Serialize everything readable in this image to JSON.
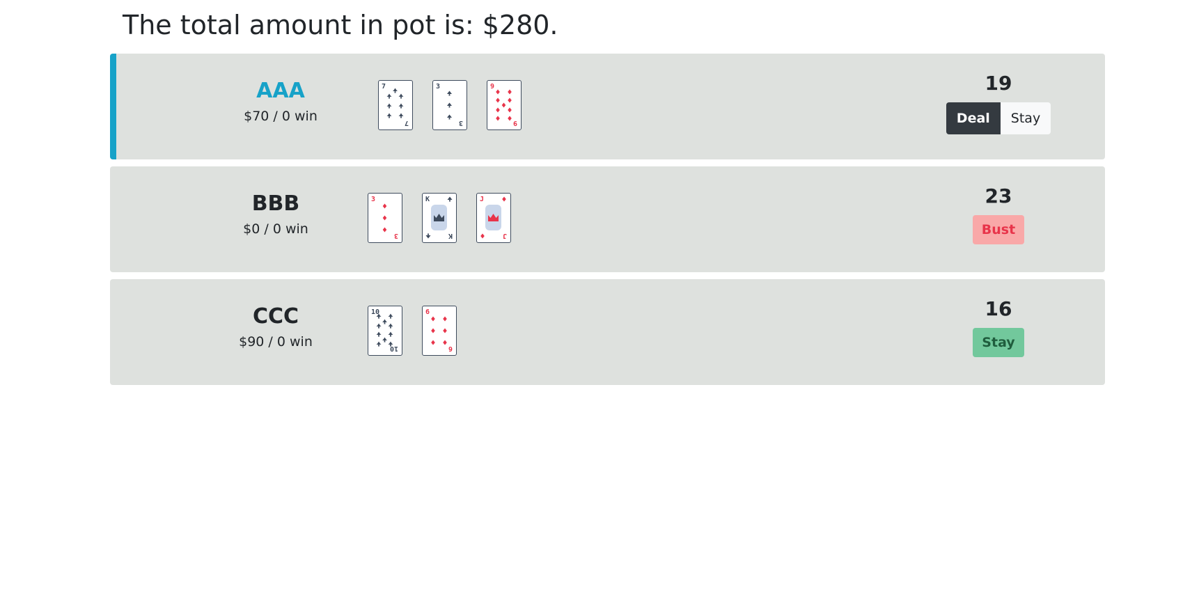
{
  "pot": {
    "title": "The total amount in pot is: $280."
  },
  "players": [
    {
      "name": "AAA",
      "money_text": "$70 / 0 win",
      "active": true,
      "score": "19",
      "status": "playing",
      "actions": {
        "deal_label": "Deal",
        "stay_label": "Stay"
      },
      "cards": [
        {
          "rank": "7",
          "suit": "clubs",
          "color": "#3d4a5c"
        },
        {
          "rank": "3",
          "suit": "spades",
          "color": "#3d4a5c"
        },
        {
          "rank": "9",
          "suit": "diamonds",
          "color": "#e8344a"
        }
      ]
    },
    {
      "name": "BBB",
      "money_text": "$0 / 0 win",
      "active": false,
      "score": "23",
      "status": "bust",
      "status_label": "Bust",
      "cards": [
        {
          "rank": "3",
          "suit": "diamonds",
          "color": "#e8344a"
        },
        {
          "rank": "K",
          "suit": "spades",
          "color": "#3d4a5c"
        },
        {
          "rank": "J",
          "suit": "diamonds",
          "color": "#e8344a"
        }
      ]
    },
    {
      "name": "CCC",
      "money_text": "$90 / 0 win",
      "active": false,
      "score": "16",
      "status": "stay",
      "status_label": "Stay",
      "cards": [
        {
          "rank": "10",
          "suit": "clubs",
          "color": "#3d4a5c"
        },
        {
          "rank": "6",
          "suit": "diamonds",
          "color": "#e8344a"
        }
      ]
    }
  ],
  "colors": {
    "active_accent": "#17a2c8",
    "row_background": "#dee1de",
    "deal_button": "#343a40",
    "bust_badge": "#f9a8a8",
    "stay_badge": "#72c89c"
  }
}
